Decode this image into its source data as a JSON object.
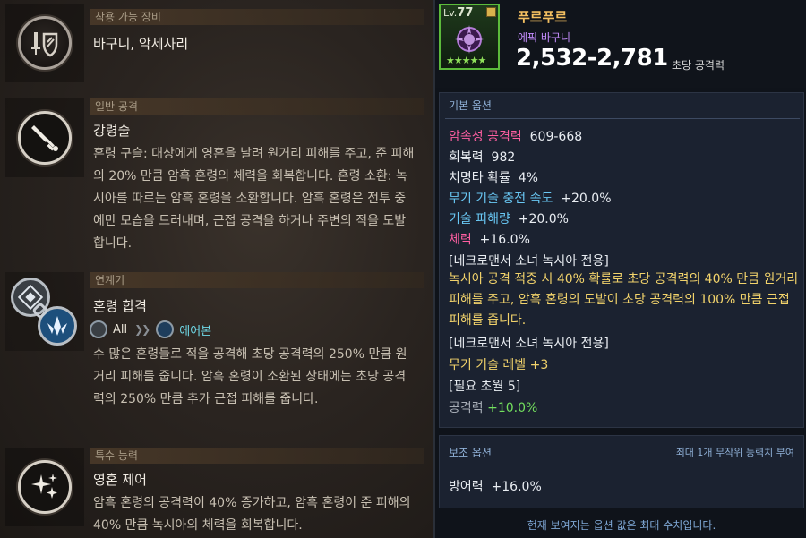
{
  "left": {
    "sections": [
      {
        "category": "착용 가능 장비",
        "title": "바구니, 악세사리",
        "icon": "sword-shield-icon"
      },
      {
        "category": "일반 공격",
        "title": "강령술",
        "icon": "dagger-icon",
        "desc": "혼령 구슬: 대상에게 영혼을 날려 원거리 피해를 주고, 준 피해의 20% 만큼 암흑 혼령의 체력을 회복합니다. 혼령 소환: 녹시아를 따르는 암흑 혼령을 소환합니다. 암흑 혼령은 전투 중에만 모습을 드러내며, 근접 공격을 하거나 주변의 적을 도발합니다."
      },
      {
        "category": "연계기",
        "title": "혼령 합격",
        "icon": "chain-combo-icon",
        "combo": {
          "from": "All",
          "to": "에어본"
        },
        "desc": "수 많은 혼령들로 적을 공격해 초당 공격력의 250% 만큼 원거리 피해를 줍니다. 암흑 혼령이 소환된 상태에는 초당 공격력의 250% 만큼 추가 근접 피해를 줍니다."
      },
      {
        "category": "특수 능력",
        "title": "영혼 제어",
        "icon": "sparkle-icon",
        "desc": "암흑 혼령의 공격력이 40% 증가하고, 암흑 혼령이 준 피해의 40% 만큼 녹시아의 체력을 회복합니다."
      }
    ]
  },
  "item": {
    "level_prefix": "Lv.",
    "level": "77",
    "stars": "★★★★★",
    "name": "푸르푸르",
    "grade": "에픽 바구니",
    "attack_range": "2,532-2,781",
    "attack_label": "초당 공격력"
  },
  "basic": {
    "header": "기본 옵션",
    "options": [
      {
        "label": "암속성 공격력",
        "value": "609-668",
        "label_color": "pink"
      },
      {
        "label": "회복력",
        "value": "982",
        "label_color": "white"
      },
      {
        "label": "치명타 확률",
        "value": "4%",
        "label_color": "white"
      },
      {
        "label": "무기 기술 충전 속도",
        "value": "+20.0%",
        "label_color": "cyan"
      },
      {
        "label": "기술 피해량",
        "value": "+20.0%",
        "label_color": "cyan"
      },
      {
        "label": "체력",
        "value": "+16.0%",
        "label_color": "pink"
      }
    ],
    "exclusive1": "[네크로맨서 소녀 녹시아 전용]",
    "effect": "녹시아 공격 적중 시 40% 확률로 초당 공격력의 40% 만큼 원거리 피해를 주고, 암흑 혼령의 도발이 초당 공격력의 100% 만큼 근접 피해를 줍니다.",
    "exclusive2": "[네크로맨서 소녀 녹시아 전용]",
    "weapon_skill": "무기 기술 레벨 +3",
    "required": "[필요 초월 5]",
    "atk_label": "공격력",
    "atk_value": "+10.0%"
  },
  "sub": {
    "header": "보조 옵션",
    "note": "최대 1개 무작위 능력치 부여",
    "option_label": "방어력",
    "option_value": "+16.0%"
  },
  "footer": "현재 보여지는 옵션 값은 최대 수치입니다.",
  "colors": {
    "epic": "#c68dff",
    "name_gold": "#f4c061",
    "frame_green": "#5cbb3b"
  }
}
